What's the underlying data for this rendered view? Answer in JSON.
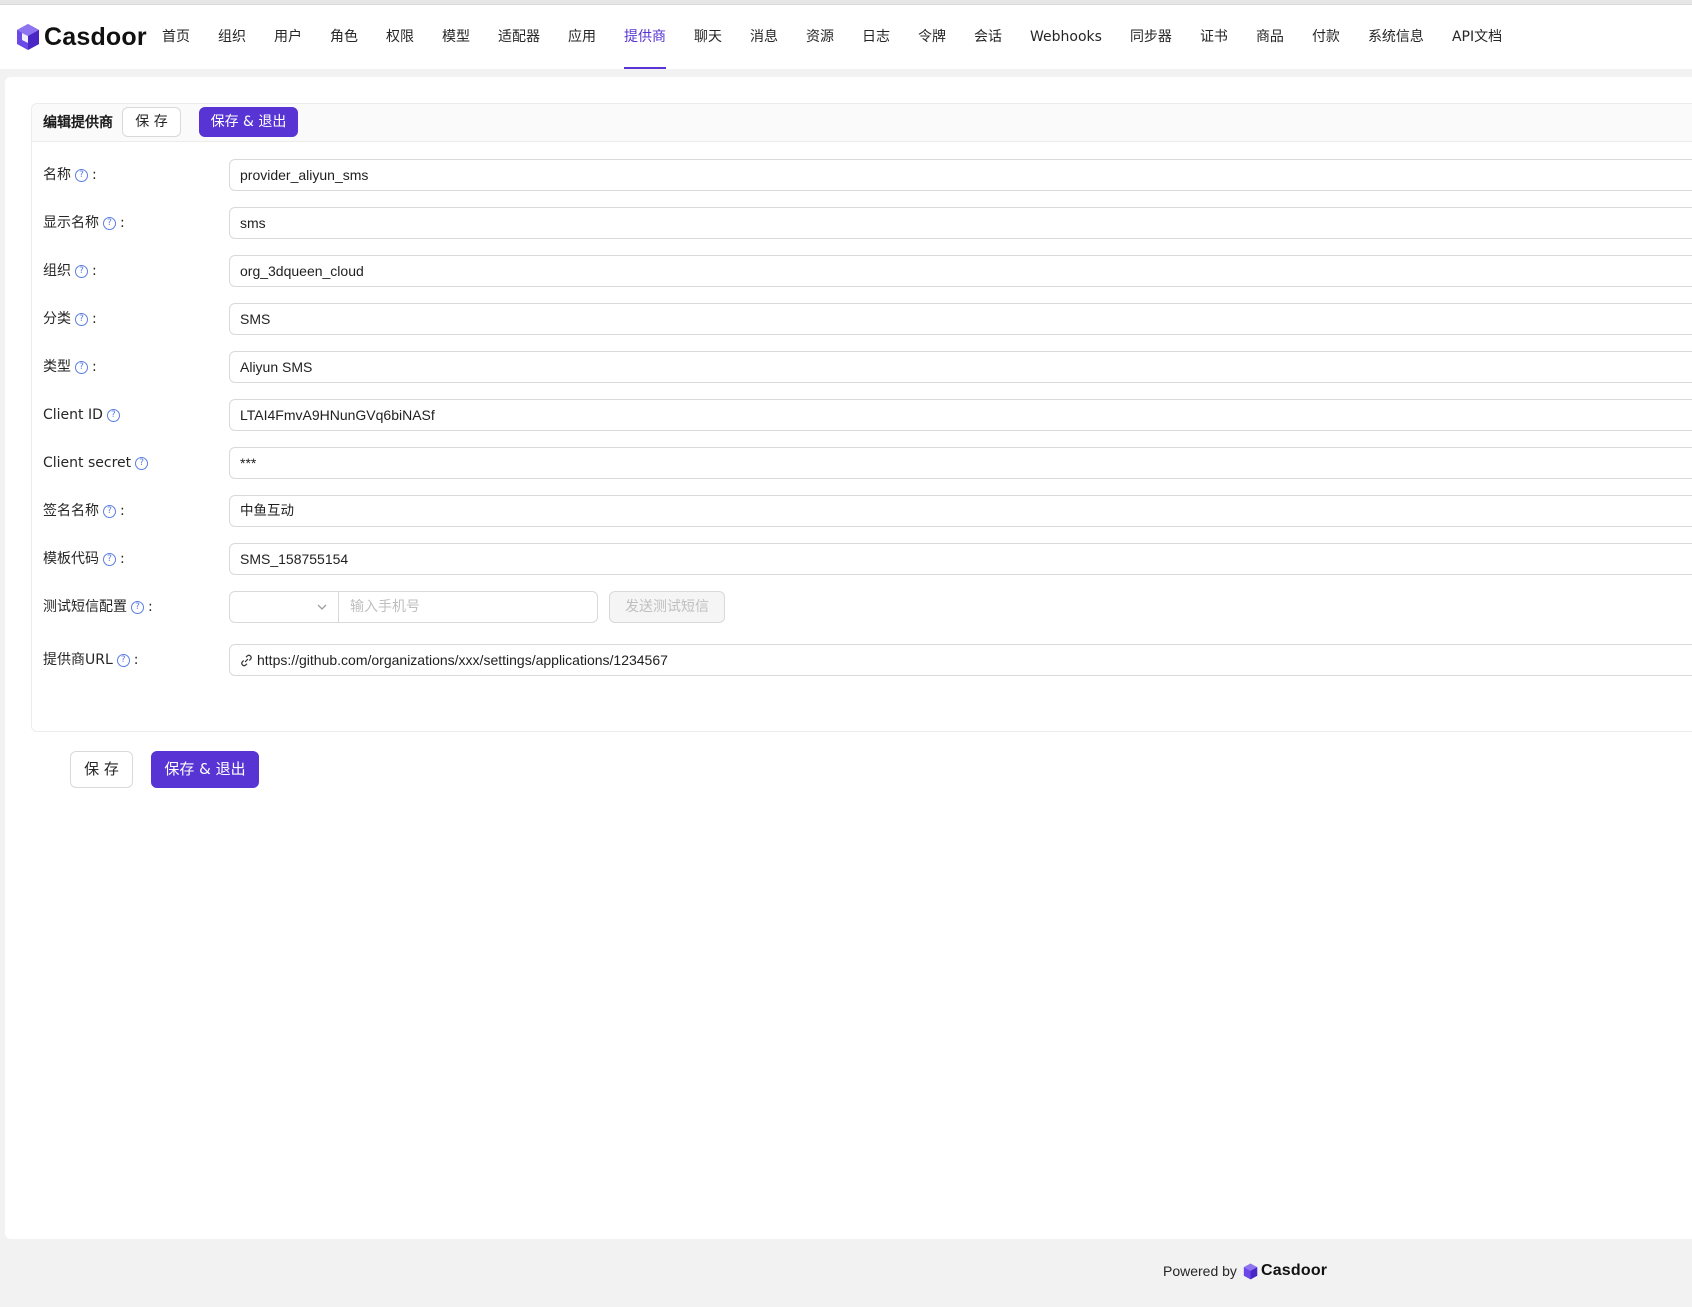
{
  "app": {
    "logo_text": "Casdoor"
  },
  "nav": {
    "items": [
      {
        "label": "首页",
        "name": "home"
      },
      {
        "label": "组织",
        "name": "organizations"
      },
      {
        "label": "用户",
        "name": "users"
      },
      {
        "label": "角色",
        "name": "roles"
      },
      {
        "label": "权限",
        "name": "permissions"
      },
      {
        "label": "模型",
        "name": "models"
      },
      {
        "label": "适配器",
        "name": "adapters"
      },
      {
        "label": "应用",
        "name": "applications"
      },
      {
        "label": "提供商",
        "name": "providers",
        "active": true
      },
      {
        "label": "聊天",
        "name": "chats"
      },
      {
        "label": "消息",
        "name": "messages"
      },
      {
        "label": "资源",
        "name": "resources"
      },
      {
        "label": "日志",
        "name": "records"
      },
      {
        "label": "令牌",
        "name": "tokens"
      },
      {
        "label": "会话",
        "name": "sessions"
      },
      {
        "label": "Webhooks",
        "name": "webhooks"
      },
      {
        "label": "同步器",
        "name": "syncers"
      },
      {
        "label": "证书",
        "name": "certs"
      },
      {
        "label": "商品",
        "name": "products"
      },
      {
        "label": "付款",
        "name": "payments"
      },
      {
        "label": "系统信息",
        "name": "sysinfo"
      },
      {
        "label": "API文档",
        "name": "swagger"
      }
    ],
    "active_color": "#5734d3"
  },
  "editor": {
    "title": "编辑提供商",
    "save_label": "保 存",
    "save_exit_label": "保存 & 退出"
  },
  "form": {
    "name": {
      "label": "名称",
      "value": "provider_aliyun_sms"
    },
    "display_name": {
      "label": "显示名称",
      "value": "sms"
    },
    "organization": {
      "label": "组织",
      "value": "org_3dqueen_cloud"
    },
    "category": {
      "label": "分类",
      "value": "SMS"
    },
    "type": {
      "label": "类型",
      "value": "Aliyun SMS"
    },
    "client_id": {
      "label": "Client ID",
      "value": "LTAI4FmvA9HNunGVq6biNASf"
    },
    "client_secret": {
      "label": "Client secret",
      "value": "***"
    },
    "sign_name": {
      "label": "签名名称",
      "value": "中鱼互动"
    },
    "template_code": {
      "label": "模板代码",
      "value": "SMS_158755154"
    },
    "test_sms": {
      "label": "测试短信配置",
      "country_code": "",
      "phone_placeholder": "输入手机号",
      "send_label": "发送测试短信"
    },
    "provider_url": {
      "label": "提供商URL",
      "value": "https://github.com/organizations/xxx/settings/applications/1234567"
    }
  },
  "footer": {
    "powered_by": "Powered by",
    "logo_text": "Casdoor"
  },
  "colors": {
    "primary": "#5734d3",
    "help_icon": "#5b7ee6"
  }
}
